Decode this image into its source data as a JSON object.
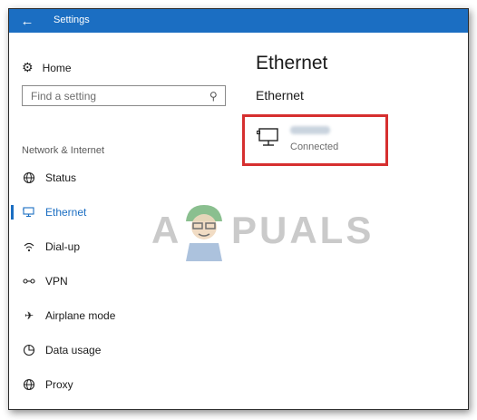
{
  "window": {
    "title": "Settings",
    "back_icon": "back-arrow-icon"
  },
  "sidebar": {
    "home_label": "Home",
    "search_placeholder": "Find a setting",
    "section_label": "Network & Internet",
    "items": [
      {
        "label": "Status",
        "icon": "globe-icon"
      },
      {
        "label": "Ethernet",
        "icon": "ethernet-icon",
        "active": true
      },
      {
        "label": "Dial-up",
        "icon": "dialup-icon"
      },
      {
        "label": "VPN",
        "icon": "vpn-icon"
      },
      {
        "label": "Airplane mode",
        "icon": "airplane-icon"
      },
      {
        "label": "Data usage",
        "icon": "data-usage-icon"
      },
      {
        "label": "Proxy",
        "icon": "proxy-globe-icon"
      }
    ]
  },
  "main": {
    "title": "Ethernet",
    "subtitle": "Ethernet",
    "network": {
      "status": "Connected"
    }
  },
  "watermark": {
    "left": "A",
    "right": "PUALS"
  },
  "colors": {
    "accent": "#1b6ec2",
    "highlight": "#d62f2f"
  }
}
